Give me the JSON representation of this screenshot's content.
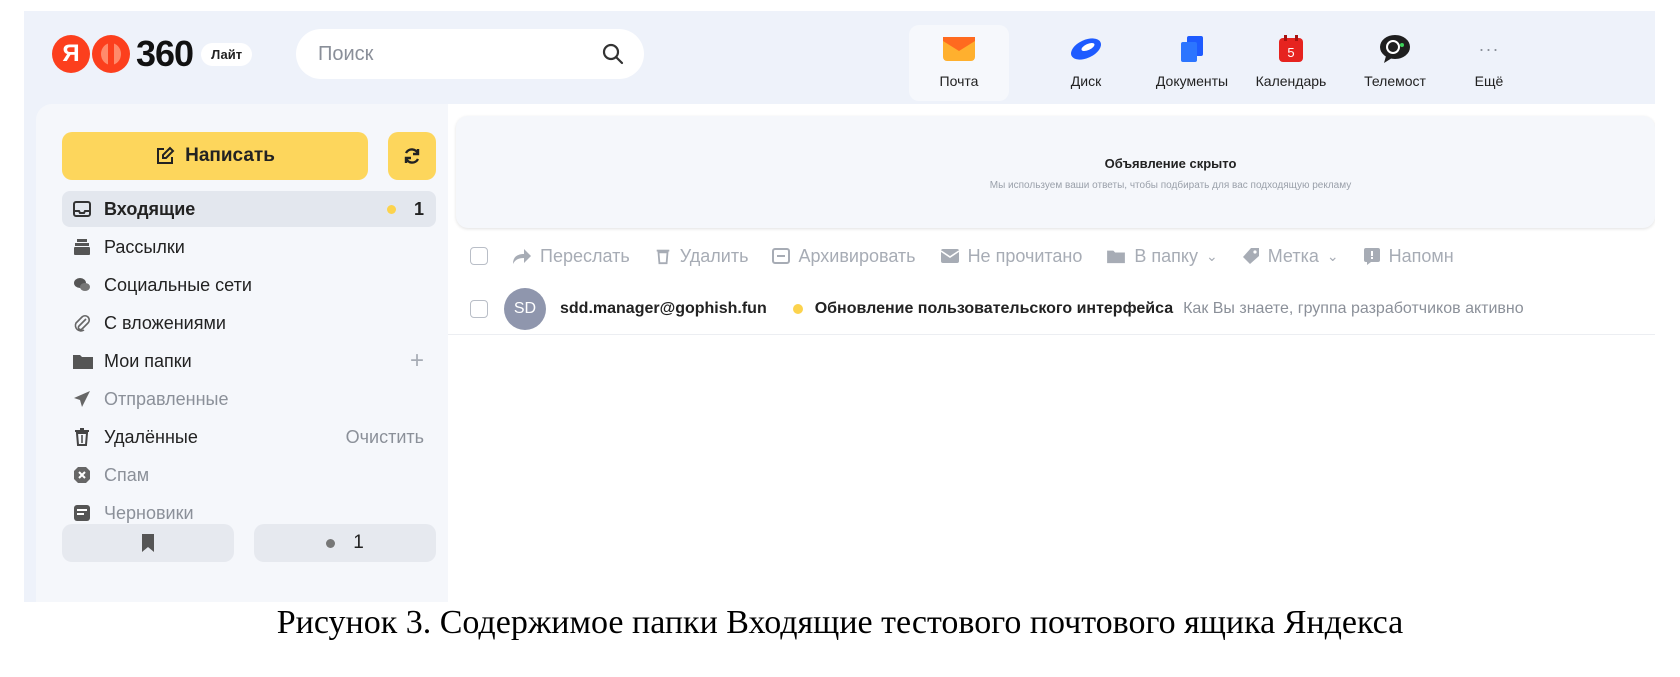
{
  "header": {
    "logo_text": "Я",
    "logo_number": "360",
    "logo_badge": "Лайт",
    "search_placeholder": "Поиск",
    "services": [
      {
        "label": "Почта",
        "icon": "mail-icon"
      },
      {
        "label": "Диск",
        "icon": "disk-icon"
      },
      {
        "label": "Документы",
        "icon": "documents-icon"
      },
      {
        "label": "Календарь",
        "icon": "calendar-icon",
        "badge": "5"
      },
      {
        "label": "Телемост",
        "icon": "telemost-icon"
      },
      {
        "label": "Ещё",
        "icon": "more-icon"
      }
    ]
  },
  "sidebar": {
    "compose_label": "Написать",
    "folders": [
      {
        "label": "Входящие",
        "count": "1",
        "icon": "inbox-icon"
      },
      {
        "label": "Рассылки",
        "icon": "newsletters-icon"
      },
      {
        "label": "Социальные сети",
        "icon": "social-icon"
      },
      {
        "label": "С вложениями",
        "icon": "attachment-icon"
      },
      {
        "label": "Мои папки",
        "icon": "folder-icon"
      },
      {
        "label": "Отправленные",
        "icon": "sent-icon"
      },
      {
        "label": "Удалённые",
        "action": "Очистить",
        "icon": "trash-icon"
      },
      {
        "label": "Спам",
        "icon": "spam-icon"
      },
      {
        "label": "Черновики",
        "icon": "drafts-icon"
      }
    ],
    "bottom_count": "1"
  },
  "ad": {
    "title": "Объявление скрыто",
    "subtitle": "Мы используем ваши ответы, чтобы подбирать для вас подходящую рекламу"
  },
  "toolbar": {
    "forward": "Переслать",
    "delete": "Удалить",
    "archive": "Архивировать",
    "unread": "Не прочитано",
    "to_folder": "В папку",
    "label": "Метка",
    "remind": "Напомн"
  },
  "messages": [
    {
      "avatar": "SD",
      "sender": "sdd.manager@gophish.fun",
      "subject": "Обновление пользовательского интерфейса",
      "snippet": "Как Вы знаете, группа разработчиков активно"
    }
  ],
  "caption": "Рисунок 3. Содержимое папки Входящие тестового почтового ящика Яндекса",
  "colors": {
    "accent_yellow": "#fdd65c",
    "header_bg": "#eef2fa",
    "avatar_bg": "#8f96ad",
    "brand_red": "#fc3f1d"
  }
}
